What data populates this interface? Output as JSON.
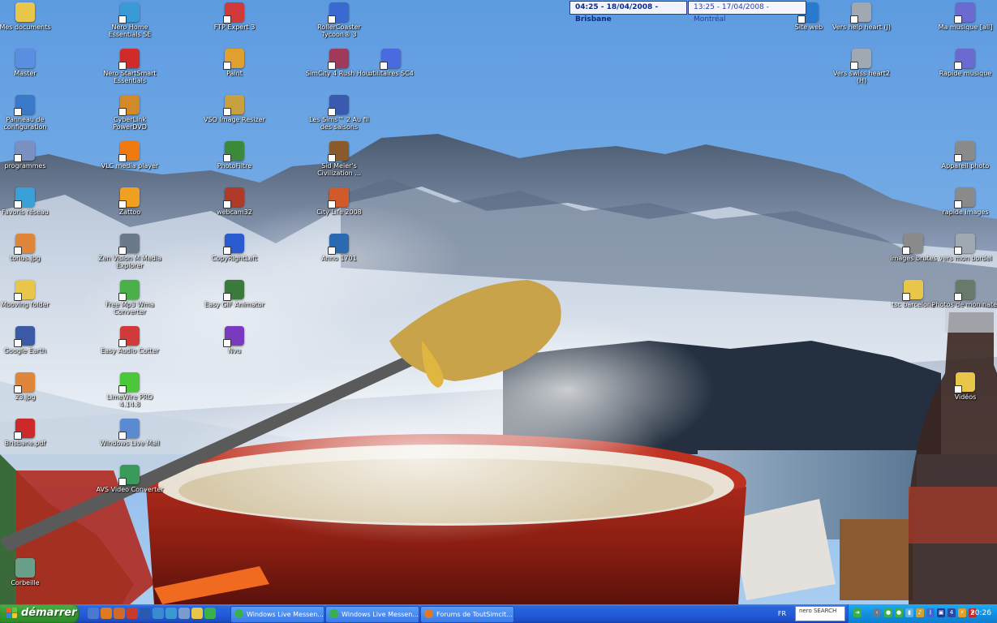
{
  "desktop": {
    "icons": [
      {
        "label": "Mes documents",
        "icon": "folder-icon",
        "color": "#e8c64a"
      },
      {
        "label": "Master",
        "icon": "computer-icon",
        "color": "#5a8ee0"
      },
      {
        "label": "Panneau de configuration",
        "icon": "control-panel-icon",
        "color": "#3a78c8"
      },
      {
        "label": "programmes",
        "icon": "programs-icon",
        "color": "#7a90c0"
      },
      {
        "label": "Favoris réseau",
        "icon": "network-icon",
        "color": "#3aa0d8"
      },
      {
        "label": "torius.jpg",
        "icon": "image-file-icon",
        "color": "#e0863a"
      },
      {
        "label": "Mooving folder",
        "icon": "folder-icon",
        "color": "#e8c64a"
      },
      {
        "label": "Google Earth",
        "icon": "google-earth-icon",
        "color": "#3a5aa8"
      },
      {
        "label": "23.jpg",
        "icon": "image-file-icon",
        "color": "#e0863a"
      },
      {
        "label": "Brisbane.pdf",
        "icon": "pdf-icon",
        "color": "#cc2a2a"
      },
      {
        "label": "Corbeille",
        "icon": "recycle-bin-icon",
        "color": "#6aa08a"
      },
      {
        "label": "Nero Home Essentials SE",
        "icon": "nero-home-icon",
        "color": "#3a9ad8"
      },
      {
        "label": "Nero StartSmart Essentials",
        "icon": "nero-startsmart-icon",
        "color": "#d02a2a"
      },
      {
        "label": "CyberLink PowerDVD",
        "icon": "powerdvd-icon",
        "color": "#d08a2a"
      },
      {
        "label": "VLC media player",
        "icon": "vlc-icon",
        "color": "#f07a10"
      },
      {
        "label": "Zattoo",
        "icon": "zattoo-icon",
        "color": "#f0a020"
      },
      {
        "label": "Zen Vision M Media Explorer",
        "icon": "zen-vision-icon",
        "color": "#6a7a8a"
      },
      {
        "label": "Free Mp3 Wma Converter",
        "icon": "converter-icon",
        "color": "#4ab04a"
      },
      {
        "label": "Easy Audio Cutter",
        "icon": "audio-cutter-icon",
        "color": "#d03a3a"
      },
      {
        "label": "LimeWire PRO 4.14.8",
        "icon": "limewire-icon",
        "color": "#4ac83a"
      },
      {
        "label": "Windows Live Mail",
        "icon": "mail-icon",
        "color": "#5a8ad0"
      },
      {
        "label": "AVS Video Converter",
        "icon": "video-converter-icon",
        "color": "#3a9a5a"
      },
      {
        "label": "FTP Expert 3",
        "icon": "ftp-icon",
        "color": "#d03a3a"
      },
      {
        "label": "Paint",
        "icon": "paint-icon",
        "color": "#e0a030"
      },
      {
        "label": "VSO Image Resizer",
        "icon": "image-resizer-icon",
        "color": "#c8a040"
      },
      {
        "label": "PhotoFiltre",
        "icon": "photofiltre-icon",
        "color": "#3a8a3a"
      },
      {
        "label": "webcam32",
        "icon": "webcam-icon",
        "color": "#b03a2a"
      },
      {
        "label": "CopyRightLeft",
        "icon": "copyright-icon",
        "color": "#2a5ad0"
      },
      {
        "label": "Easy GIF Animator",
        "icon": "gif-animator-icon",
        "color": "#3a7a3a"
      },
      {
        "label": "Nvu",
        "icon": "nvu-icon",
        "color": "#7a3ac0"
      },
      {
        "label": "RollerCoaster Tycoon® 3",
        "icon": "game-icon",
        "color": "#3a6ad0"
      },
      {
        "label": "SimCity 4 Rush Hour",
        "icon": "game-icon",
        "color": "#a03a5a"
      },
      {
        "label": "Les Sims™ 2 Au fil des saisons",
        "icon": "game-icon",
        "color": "#3a5ab0"
      },
      {
        "label": "Sid Meier's Civilization ...",
        "icon": "game-icon",
        "color": "#8a5a2a"
      },
      {
        "label": "City Life 2008",
        "icon": "game-icon",
        "color": "#d05a2a"
      },
      {
        "label": "Anno 1701",
        "icon": "game-icon",
        "color": "#2a6ab0"
      },
      {
        "label": "utilitaires SC4",
        "icon": "gear-icon",
        "color": "#4a6ae0"
      },
      {
        "label": "Site web",
        "icon": "globe-icon",
        "color": "#2a7ad0"
      },
      {
        "label": "Vers help heart (J)",
        "icon": "drive-icon",
        "color": "#a0a8b0"
      },
      {
        "label": "Vers swiss heart2 (H)",
        "icon": "drive-icon",
        "color": "#a0a8b0"
      },
      {
        "label": "Ma musique [all]",
        "icon": "music-icon",
        "color": "#6a6ad0"
      },
      {
        "label": "Rapide musique",
        "icon": "music-icon",
        "color": "#6a6ad0"
      },
      {
        "label": "Appareil photo",
        "icon": "camera-icon",
        "color": "#8a8a8a"
      },
      {
        "label": "rapide images",
        "icon": "camera-icon",
        "color": "#8a8a8a"
      },
      {
        "label": "images brutes",
        "icon": "camera-icon",
        "color": "#8a8a8a"
      },
      {
        "label": "vers mon bordel",
        "icon": "drive-icon",
        "color": "#a0a8b0"
      },
      {
        "label": "tsc barcelone",
        "icon": "folder-icon",
        "color": "#e8c64a"
      },
      {
        "label": "Photos de mon natel",
        "icon": "phone-icon",
        "color": "#6a7a6a"
      },
      {
        "label": "Vidéos",
        "icon": "folder-icon",
        "color": "#e8c64a"
      }
    ]
  },
  "clocks": [
    {
      "text": "04:25 - 18/04/2008 - Brisbane"
    },
    {
      "text": "13:25 - 17/04/2008 - Montréal"
    }
  ],
  "taskbar": {
    "start_label": "démarrer",
    "quick_launch": [
      {
        "icon": "show-desktop-icon",
        "color": "#4a7ad0"
      },
      {
        "icon": "firefox-icon",
        "color": "#e07a20"
      },
      {
        "icon": "firefox-icon",
        "color": "#d06a2a"
      },
      {
        "icon": "nero-icon",
        "color": "#c83a2a"
      },
      {
        "icon": "media-player-icon",
        "color": "#2a5ab0"
      },
      {
        "icon": "internet-explorer-icon",
        "color": "#3a8ad0"
      },
      {
        "icon": "globe-icon",
        "color": "#3a9ad0"
      },
      {
        "icon": "mail-icon",
        "color": "#7a9ad0"
      },
      {
        "icon": "folder-icon",
        "color": "#e8c64a"
      },
      {
        "icon": "messenger-icon",
        "color": "#3ab04a"
      }
    ],
    "tasks": [
      {
        "label": "Windows Live Messen...",
        "icon": "messenger-icon",
        "color": "#3ab04a"
      },
      {
        "label": "Windows Live Messen...",
        "icon": "messenger-icon",
        "color": "#3ab04a"
      },
      {
        "label": "Forums de ToutSimcit...",
        "icon": "firefox-icon",
        "color": "#e07a20"
      }
    ],
    "language": "FR",
    "nero_search": "nero SEARCH",
    "tray_time": "20:26"
  }
}
